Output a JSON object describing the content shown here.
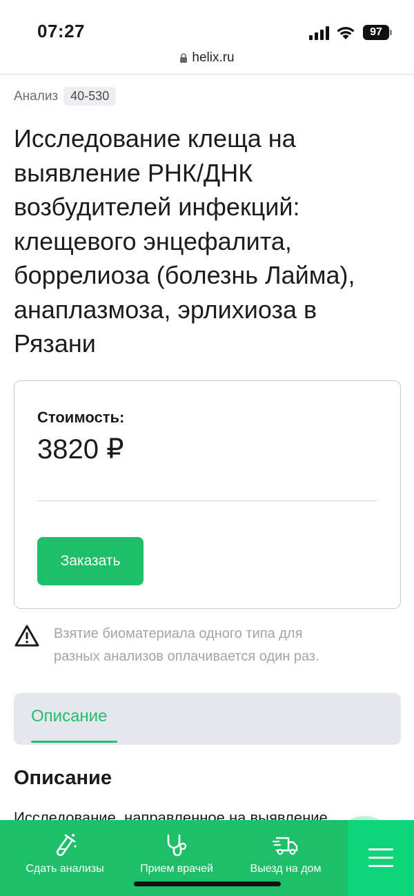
{
  "status_bar": {
    "time": "07:27",
    "battery": "97",
    "icons": [
      "signal-icon",
      "wifi-icon",
      "battery-icon"
    ]
  },
  "browser": {
    "url": "helix.ru",
    "icon": "lock-icon"
  },
  "analysis": {
    "label": "Анализ",
    "code": "40-530"
  },
  "title_lines": [
    "Исследование клеща на",
    "выявление РНК/ДНК",
    "возбудителей инфекций:",
    "клещевого энцефалита,",
    "боррелиоза (болезнь Лайма),",
    "анаплазмоза, эрлихиоза в",
    "Рязани"
  ],
  "price_card": {
    "label": "Стоимость:",
    "price": "3820 ₽",
    "order_button": "Заказать"
  },
  "notice": {
    "icon": "warning-icon",
    "lines": [
      "Взятие биоматериала одного типа для",
      "разных анализов оплачивается один раз."
    ]
  },
  "tabs": {
    "active": "Описание"
  },
  "description": {
    "heading": "Описание",
    "body_partial": "Исследование, направленное на выявление"
  },
  "chat": {
    "icon": "chat-icon"
  },
  "bottom_nav": {
    "items": [
      {
        "label": "Сдать анализы",
        "icon": "test-tube-icon"
      },
      {
        "label": "Прием врачей",
        "icon": "stethoscope-icon"
      },
      {
        "label": "Выезд на дом",
        "icon": "delivery-truck-icon"
      }
    ],
    "menu_icon": "hamburger-menu-icon"
  },
  "colors": {
    "brand_green": "#1fbf6a",
    "menu_green": "#10d47a",
    "tab_background": "#e6e7ee",
    "muted_text": "#a4a4a4"
  }
}
